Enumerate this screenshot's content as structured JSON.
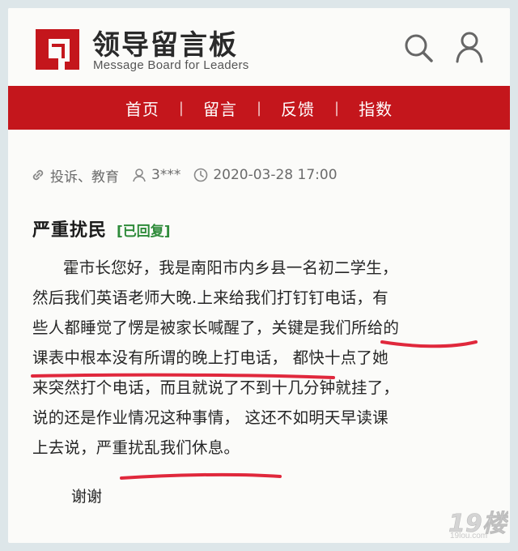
{
  "brand": {
    "title": "领导留言板",
    "subtitle": "Message Board for Leaders"
  },
  "header_icons": [
    "search-icon",
    "user-icon"
  ],
  "nav": {
    "items": [
      {
        "label": "首页"
      },
      {
        "label": "留言"
      },
      {
        "label": "反馈"
      },
      {
        "label": "指数"
      }
    ],
    "separator": "|"
  },
  "meta": {
    "category": "投诉、教育",
    "author": "3***",
    "datetime": "2020-03-28 17:00"
  },
  "post": {
    "title": "严重扰民",
    "status": "[已回复]",
    "lines": [
      "霍市长您好，我是南阳市内乡县一名初二学生，",
      "然后我们英语老师大晚.上来给我们打钉钉电话，有",
      "些人都睡觉了愣是被家长喊醒了，关键是我们所给的",
      "课表中根本没有所谓的晚上打电话， 都快十点了她",
      "来突然打个电话，而且就说了不到十几分钟就挂了，",
      "说的还是作业情况这种事情， 这还不如明天早读课",
      "上去说，严重扰乱我们休息。"
    ],
    "closing": "谢谢"
  },
  "colors": {
    "brand_red": "#c4161c",
    "status_green": "#2e8b3a",
    "underline_red": "#e0283c"
  },
  "watermark": {
    "logo": "19楼",
    "site": "19lou.com"
  }
}
